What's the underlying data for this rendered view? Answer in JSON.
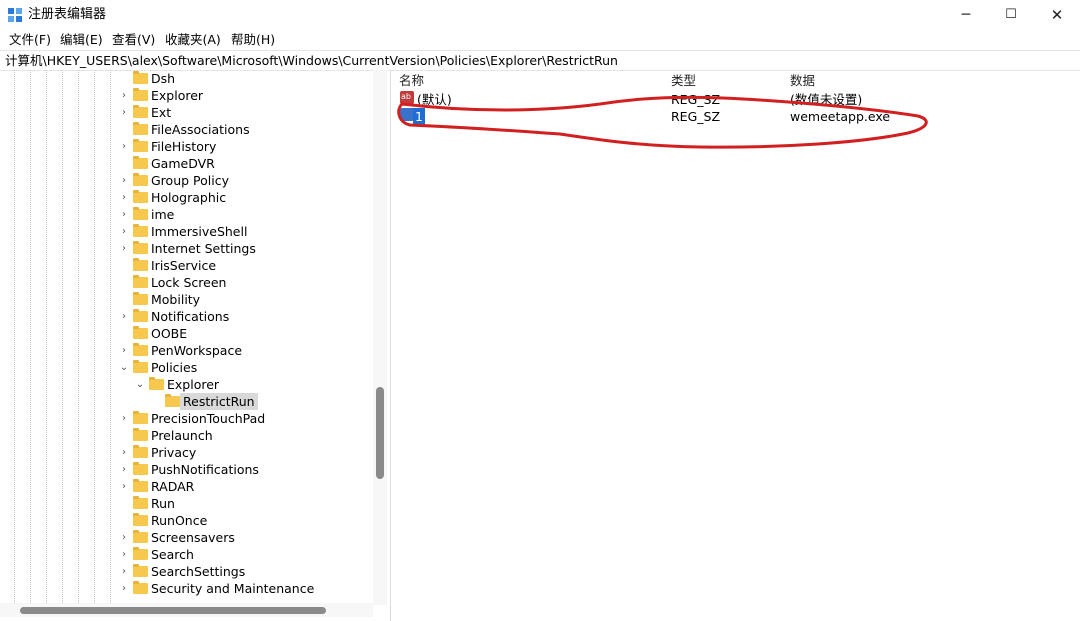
{
  "window": {
    "title": "注册表编辑器",
    "controls": {
      "minimize": "─",
      "maximize": "☐",
      "close": "✕"
    }
  },
  "menu": [
    "文件(F)",
    "编辑(E)",
    "查看(V)",
    "收藏夹(A)",
    "帮助(H)"
  ],
  "address": "计算机\\HKEY_USERS\\alex\\Software\\Microsoft\\Windows\\CurrentVersion\\Policies\\Explorer\\RestrictRun",
  "tree": {
    "items": [
      {
        "label": "Dsh",
        "expander": ""
      },
      {
        "label": "Explorer",
        "expander": "›"
      },
      {
        "label": "Ext",
        "expander": "›"
      },
      {
        "label": "FileAssociations",
        "expander": ""
      },
      {
        "label": "FileHistory",
        "expander": "›"
      },
      {
        "label": "GameDVR",
        "expander": ""
      },
      {
        "label": "Group Policy",
        "expander": "›"
      },
      {
        "label": "Holographic",
        "expander": "›"
      },
      {
        "label": "ime",
        "expander": "›"
      },
      {
        "label": "ImmersiveShell",
        "expander": "›"
      },
      {
        "label": "Internet Settings",
        "expander": "›"
      },
      {
        "label": "IrisService",
        "expander": ""
      },
      {
        "label": "Lock Screen",
        "expander": ""
      },
      {
        "label": "Mobility",
        "expander": ""
      },
      {
        "label": "Notifications",
        "expander": "›"
      },
      {
        "label": "OOBE",
        "expander": ""
      },
      {
        "label": "PenWorkspace",
        "expander": "›"
      },
      {
        "label": "Policies",
        "expander": "⌄"
      },
      {
        "label": "Explorer",
        "expander": "⌄"
      },
      {
        "label": "RestrictRun",
        "expander": ""
      },
      {
        "label": "PrecisionTouchPad",
        "expander": "›"
      },
      {
        "label": "Prelaunch",
        "expander": ""
      },
      {
        "label": "Privacy",
        "expander": "›"
      },
      {
        "label": "PushNotifications",
        "expander": "›"
      },
      {
        "label": "RADAR",
        "expander": "›"
      },
      {
        "label": "Run",
        "expander": ""
      },
      {
        "label": "RunOnce",
        "expander": ""
      },
      {
        "label": "Screensavers",
        "expander": "›"
      },
      {
        "label": "Search",
        "expander": "›"
      },
      {
        "label": "SearchSettings",
        "expander": "›"
      },
      {
        "label": "Security and Maintenance",
        "expander": "›"
      }
    ],
    "selected": "RestrictRun"
  },
  "list": {
    "headers": {
      "name": "名称",
      "type": "类型",
      "data": "数据"
    },
    "rows": [
      {
        "name": "(默认)",
        "type": "REG_SZ",
        "data": "(数值未设置)"
      },
      {
        "name": "1",
        "type": "REG_SZ",
        "data": "wemeetapp.exe",
        "selected": true
      }
    ]
  },
  "colors": {
    "folder": "#f6c94e",
    "selection": "#1f6ed4",
    "annotation": "#d21f1f"
  }
}
